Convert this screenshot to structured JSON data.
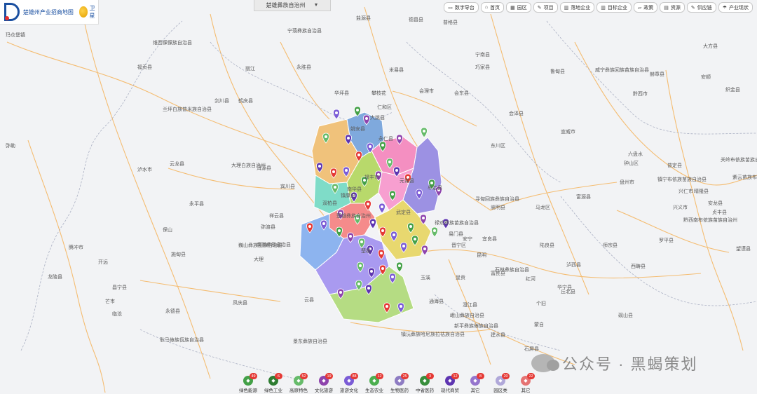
{
  "header": {
    "logo_text": "楚雄州产业招商地图",
    "satellite_label": "卫星",
    "region_select": "楚雄彝族自治州",
    "region_chevron": "▼"
  },
  "toolbar": [
    {
      "icon": "monitor-icon",
      "glyph": "▭",
      "label": "数字导台"
    },
    {
      "icon": "home-icon",
      "glyph": "⌂",
      "label": "首页"
    },
    {
      "icon": "park-icon",
      "glyph": "▦",
      "label": "园区"
    },
    {
      "icon": "project-icon",
      "glyph": "✎",
      "label": "项目"
    },
    {
      "icon": "enterprise-icon",
      "glyph": "▥",
      "label": "落地企业"
    },
    {
      "icon": "target-enterprise-icon",
      "glyph": "▥",
      "label": "目标企业"
    },
    {
      "icon": "policy-icon",
      "glyph": "▱",
      "label": "政策"
    },
    {
      "icon": "resource-icon",
      "glyph": "▤",
      "label": "资源"
    },
    {
      "icon": "supply-chain-icon",
      "glyph": "✎",
      "label": "供应链"
    },
    {
      "icon": "industry-status-icon",
      "glyph": "☂",
      "label": "产业现状"
    }
  ],
  "categories": [
    {
      "label": "绿色能源",
      "count": "49",
      "color": "#43a047"
    },
    {
      "label": "绿色工业",
      "count": "6",
      "color": "#2e7d32"
    },
    {
      "label": "高原特色",
      "count": "52",
      "color": "#66bb6a"
    },
    {
      "label": "文化旅游",
      "count": "19",
      "color": "#8e44ad"
    },
    {
      "label": "旅游文化",
      "count": "88",
      "color": "#7b5cd6"
    },
    {
      "label": "生态农业",
      "count": "12",
      "color": "#4caf50"
    },
    {
      "label": "生物医药",
      "count": "25",
      "color": "#8e7cc3"
    },
    {
      "label": "中省医药",
      "count": "3",
      "color": "#388e3c"
    },
    {
      "label": "现代商贸",
      "count": "12",
      "color": "#5e35b1"
    },
    {
      "label": "其它",
      "count": "8",
      "color": "#9575cd"
    },
    {
      "label": "园区类",
      "count": "20",
      "color": "#b0a8d9"
    },
    {
      "label": "其它",
      "count": "22",
      "color": "#e57373"
    }
  ],
  "map_labels": [
    "玛仓堡镇",
    "维西傈僳族自治县",
    "宁蒗彝族自治县",
    "盐源县",
    "德昌县",
    "普格县",
    "福贡县",
    "丽江",
    "永胜县",
    "华坪县",
    "攀枝花",
    "仁和区",
    "会理市",
    "会东县",
    "宁南县",
    "巧家县",
    "鲁甸县",
    "威宁彝族回族苗族自治县",
    "赫章县",
    "大方县",
    "黔西市",
    "织金县",
    "兰坪白族普米族自治县",
    "剑川县",
    "鹤庆县",
    "米易县",
    "会泽县",
    "宣威市",
    "六盘水",
    "钟山区",
    "普定县",
    "安顺",
    "镇宁布依族苗族自治县",
    "关岭布依族苗族自治县",
    "晴隆县",
    "紫云苗族布依族自治县",
    "安龙县",
    "泸水市",
    "云龙县",
    "洱源县",
    "大理白族自治州",
    "宾川县",
    "东川区",
    "寻甸回族彝族自治县",
    "马龙区",
    "富源县",
    "盘州市",
    "兴义市",
    "贞丰县",
    "兴仁市",
    "望谟县",
    "黔西南布依族苗族自治州",
    "罗平县",
    "保山",
    "施甸县",
    "巍山彝族回族自治县",
    "南涧彝族自治县",
    "弥渡县",
    "祥云县",
    "永平县",
    "大理",
    "昆明",
    "嵩明县",
    "宜良县",
    "石林彝族自治县",
    "陆良县",
    "师宗县",
    "泸西县",
    "丘北县",
    "西畴县",
    "砚山县",
    "开远",
    "昌宁县",
    "凤庆县",
    "云县",
    "景东彝族自治县",
    "镇沅彝族哈尼族拉祜族自治县",
    "新平彝族傣族自治县",
    "峨山彝族自治县",
    "通海县",
    "玉溪",
    "易门县",
    "安宁",
    "晋宁区",
    "呈贡",
    "澄江县",
    "华宁县",
    "弥勒",
    "腾冲市",
    "龙陵县",
    "芒市",
    "临沧",
    "永德县",
    "耿马傣族佤族自治县",
    "镇康县",
    "楚雄彝族自治州",
    "楚雄",
    "双柏县",
    "南华县",
    "姚安县",
    "大姚县",
    "永仁县",
    "元谋县",
    "武定县",
    "禄丰市",
    "牟定县",
    "禄劝彝族苗族自治县",
    "富民县",
    "红河",
    "个旧",
    "蒙自",
    "建水县",
    "石屏县",
    "元江县"
  ],
  "watermark": "公众号 · 黑蝎策划"
}
